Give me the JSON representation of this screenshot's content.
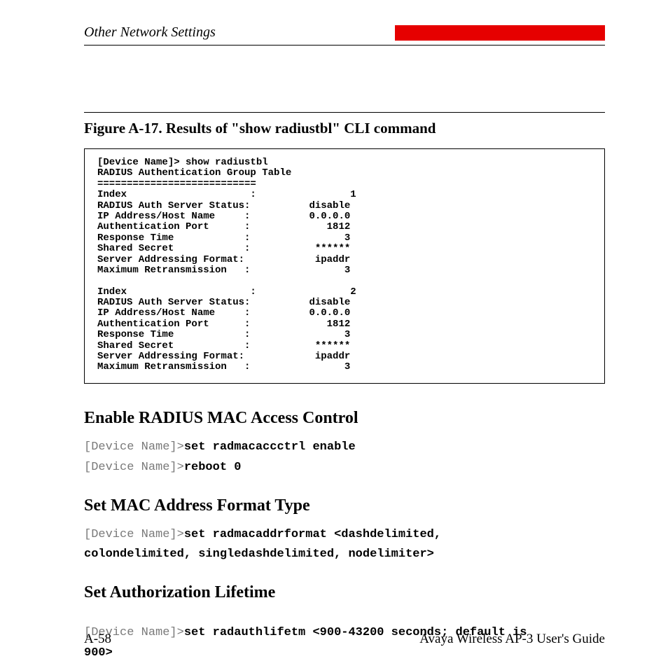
{
  "header": {
    "running_head": "Other Network Settings"
  },
  "figure": {
    "caption": "Figure A-17.    Results of \"show radiustbl\" CLI command",
    "cli": "[Device Name]> show radiustbl\nRADIUS Authentication Group Table\n===========================\nIndex                     :                1\nRADIUS Auth Server Status:          disable\nIP Address/Host Name     :          0.0.0.0\nAuthentication Port      :             1812\nResponse Time            :                3\nShared Secret            :           ******\nServer Addressing Format:            ipaddr\nMaximum Retransmission   :                3\n\nIndex                     :                2\nRADIUS Auth Server Status:          disable\nIP Address/Host Name     :          0.0.0.0\nAuthentication Port      :             1812\nResponse Time            :                3\nShared Secret            :           ******\nServer Addressing Format:            ipaddr\nMaximum Retransmission   :                3"
  },
  "sections": {
    "s1": {
      "title": "Enable RADIUS MAC Access Control",
      "line1_prompt": "[Device Name]>",
      "line1_cmd": "set radmacaccctrl enable",
      "line2_prompt": "[Device Name]>",
      "line2_cmd": "reboot 0"
    },
    "s2": {
      "title": "Set MAC Address Format Type",
      "prompt": "[Device Name]>",
      "cmd_a": "set radmacaddrformat <dashdelimited,",
      "cmd_b": "colondelimited, singledashdelimited, nodelimiter>"
    },
    "s3": {
      "title": "Set Authorization Lifetime",
      "prompt": "[Device Name]>",
      "cmd_a": "set radauthlifetm <900-43200 seconds; default is",
      "cmd_b": "900>"
    }
  },
  "footer": {
    "left": "A-58",
    "right": "Avaya Wireless AP-3 User's Guide"
  }
}
